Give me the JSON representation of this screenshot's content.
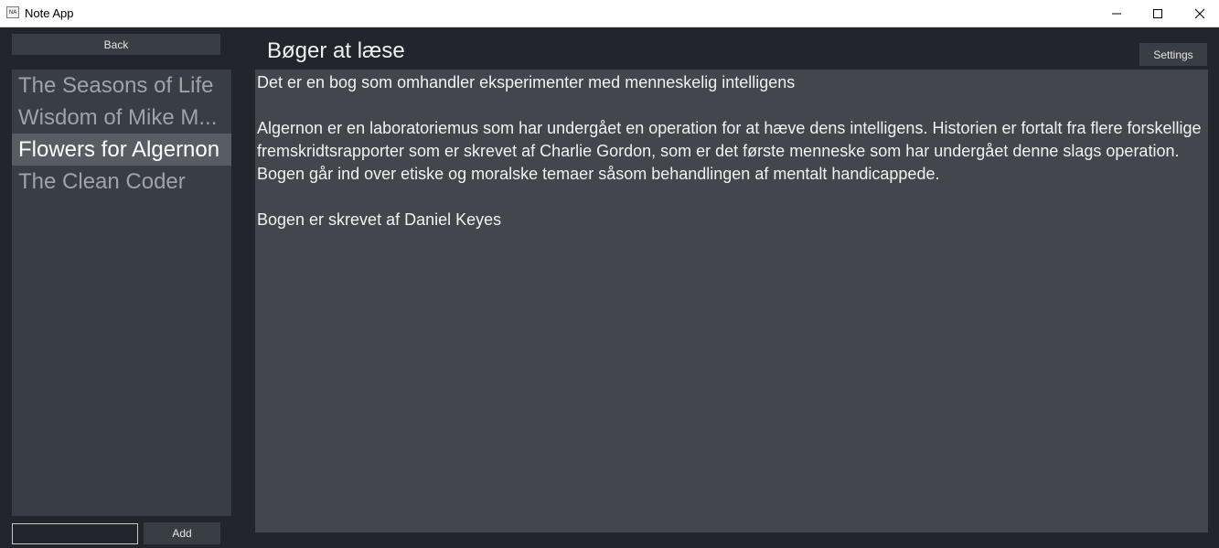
{
  "window": {
    "title": "Note App",
    "icon": "app-icon"
  },
  "window_controls": {
    "minimize_icon": "minimize-icon",
    "maximize_icon": "maximize-icon",
    "close_icon": "close-icon"
  },
  "sidebar": {
    "back_label": "Back",
    "notes": [
      {
        "title": "The Seasons of Life",
        "selected": false
      },
      {
        "title": "Wisdom of Mike M...",
        "selected": false
      },
      {
        "title": "Flowers for Algernon",
        "selected": true
      },
      {
        "title": "The Clean Coder",
        "selected": false
      }
    ],
    "new_note_value": "",
    "add_label": "Add"
  },
  "main": {
    "title": "Bøger at læse",
    "settings_label": "Settings",
    "paragraphs": [
      "Det er en bog som omhandler eksperimenter med menneskelig intelligens",
      "Algernon er en laboratoriemus som har undergået en operation for at hæve dens intelligens. Historien er fortalt fra flere forskellige fremskridtsrapporter som er skrevet af Charlie Gordon, som er det første menneske som har undergået denne slags operation. Bogen går ind over etiske og moralske temaer såsom behandlingen af mentalt handicappede.",
      "Bogen er skrevet af Daniel Keyes"
    ]
  },
  "colors": {
    "background": "#22262c",
    "panel": "#393d44",
    "editor": "#43464c",
    "selected_item": "#585c63",
    "muted_text": "#9fa3a9"
  }
}
